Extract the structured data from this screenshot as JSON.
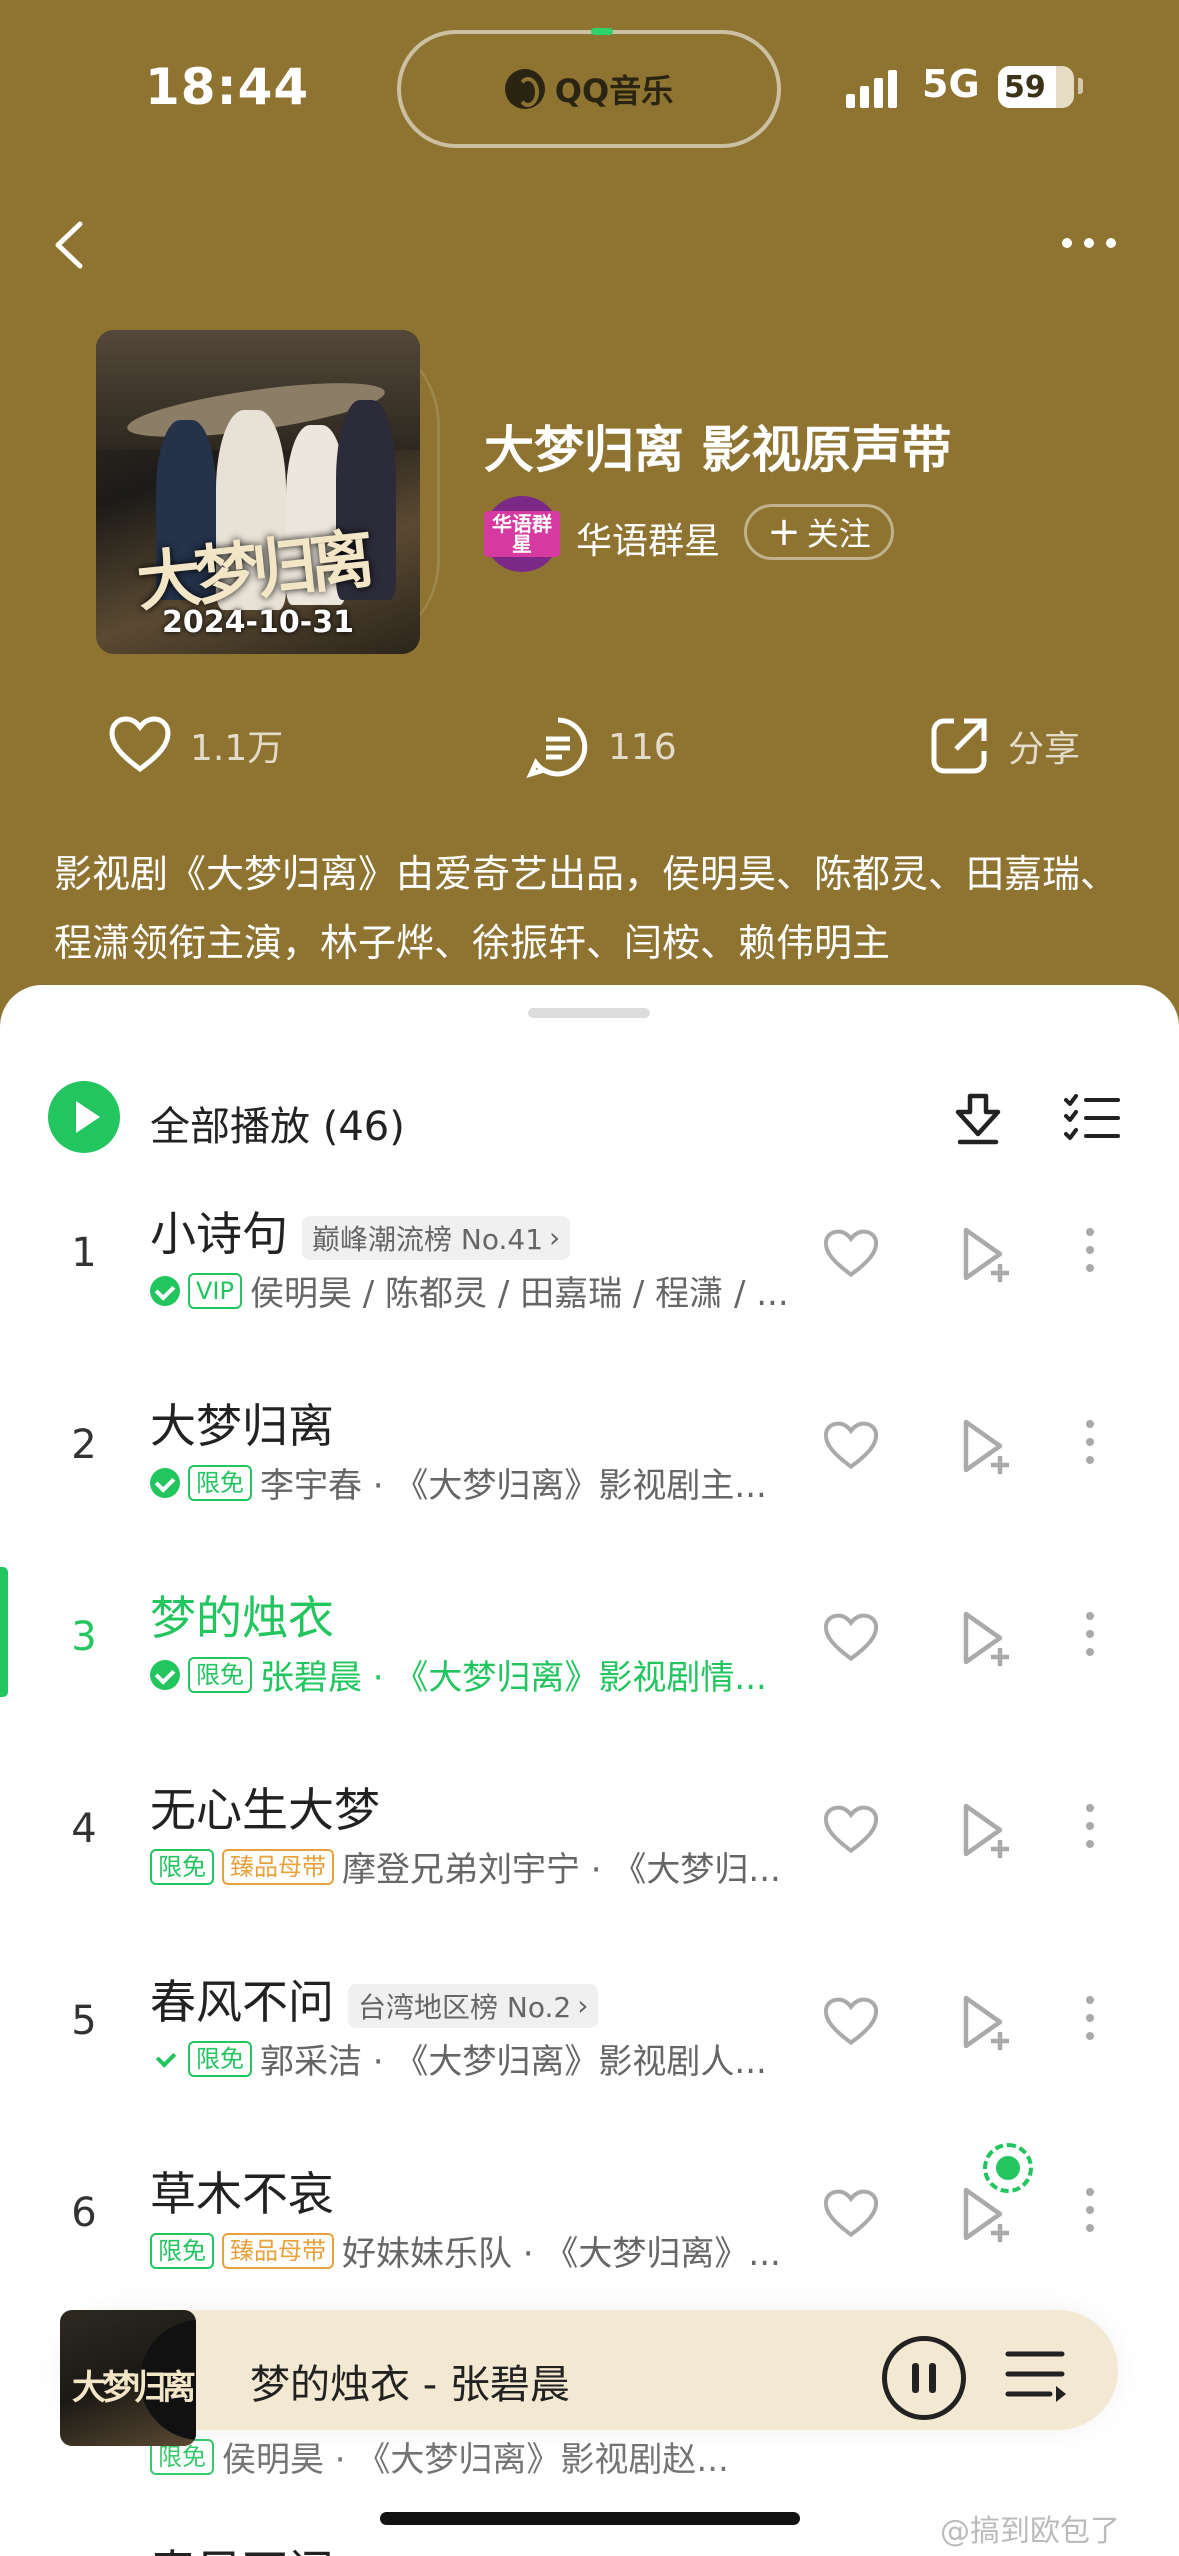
{
  "status": {
    "time": "18:44",
    "network": "5G",
    "battery": "59",
    "island_app": "QQ音乐"
  },
  "album": {
    "title": "大梦归离 影视原声带",
    "cover_title": "大梦归离",
    "cover_date": "2024-10-31",
    "artist": "华语群星",
    "artist_avatar": "华语群星",
    "follow_label": "关注"
  },
  "stats": {
    "likes": "1.1万",
    "comments": "116",
    "share": "分享"
  },
  "description": "影视剧《大梦归离》由爱奇艺出品，侯明昊、陈都灵、田嘉瑞、程潇领衔主演，林子烨、徐振轩、闫桉、赖伟明主",
  "playall": {
    "label": "全部播放",
    "count": "(46)"
  },
  "songs": [
    {
      "num": "1",
      "title": "小诗句",
      "badge": "巅峰潮流榜 No.41",
      "tags": [
        "VIP"
      ],
      "check": "solid",
      "artists": "侯明昊 / 陈都灵 / 田嘉瑞 / 程潇 / ..."
    },
    {
      "num": "2",
      "title": "大梦归离",
      "badge": "",
      "tags": [
        "限免"
      ],
      "check": "solid",
      "artists": "李宇春 · 《大梦归离》影视剧主..."
    },
    {
      "num": "3",
      "title": "梦的烛衣",
      "badge": "",
      "tags": [
        "限免"
      ],
      "check": "solid",
      "artists": "张碧晨 · 《大梦归离》影视剧情..."
    },
    {
      "num": "4",
      "title": "无心生大梦",
      "badge": "",
      "tags": [
        "限免",
        "臻品母带"
      ],
      "check": "none",
      "artists": "摩登兄弟刘宇宁 · 《大梦归..."
    },
    {
      "num": "5",
      "title": "春风不问",
      "badge": "台湾地区榜 No.2",
      "tags": [
        "限免"
      ],
      "check": "light",
      "artists": "郭采洁 · 《大梦归离》影视剧人..."
    },
    {
      "num": "6",
      "title": "草木不哀",
      "badge": "",
      "tags": [
        "限免",
        "臻品母带"
      ],
      "check": "none",
      "artists": "好妹妹乐队 · 《大梦归离》..."
    }
  ],
  "partial_row": {
    "tag": "限免",
    "artists": "侯明昊 · 《大梦归离》影视剧赵...",
    "next_title": "春风不问"
  },
  "player": {
    "title": "梦的烛衣 - 张碧晨",
    "cover_title": "大梦归离"
  },
  "watermark": "@搞到欧包了",
  "colors": {
    "accent": "#22c55e",
    "header_bg": "#8e7331",
    "player_bg": "#f3e8d1",
    "gold": "#e6a23c"
  }
}
